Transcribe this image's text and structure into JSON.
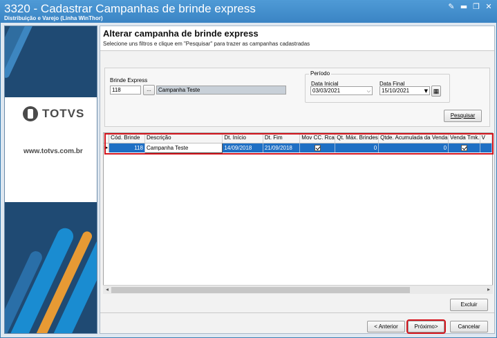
{
  "window": {
    "title": "3320 - Cadastrar Campanhas de brinde express",
    "subtitle": "Distribuição e Varejo (Linha WinThor)"
  },
  "banner": {
    "brand": "TOTVS",
    "site": "www.totvs.com.br"
  },
  "header": {
    "title": "Alterar campanha de brinde express",
    "instruction": "Selecione uns filtros e clique em \"Pesquisar\" para trazer as campanhas cadastradas"
  },
  "filters": {
    "brinde_label": "Brinde Express",
    "brinde_code": "118",
    "brinde_lookup_label": "...",
    "brinde_desc": "Campanha Teste",
    "periodo_label": "Período",
    "data_inicial_label": "Data Inicial",
    "data_inicial": "03/03/2021",
    "data_final_label": "Data Final",
    "data_final": "15/10/2021",
    "search_label": "Pesquisar"
  },
  "grid": {
    "columns": [
      "Cód. Brinde",
      "Descrição",
      "Dt. Início",
      "Dt. Fim",
      "Mov CC. Rca",
      "Qt. Máx. Brindes",
      "Qtde. Acumulada da Venda",
      "Venda Tmk.",
      "V"
    ],
    "rows": [
      {
        "cod": "118",
        "descricao": "Campanha Teste",
        "dt_inicio": "14/09/2018",
        "dt_fim": "21/09/2018",
        "mov_cc_rca": true,
        "qt_max_brindes": "0",
        "qtde_acumulada": "0",
        "venda_tmk": true
      }
    ]
  },
  "footer": {
    "excluir_label": "Excluir",
    "anterior_label": "< Anterior",
    "proximo_label": "Próximo>",
    "cancelar_label": "Cancelar"
  },
  "colors": {
    "titlebar": "#3a84c4",
    "selection": "#1e6fc4",
    "highlight": "#d4141c",
    "banner": "#1f4a73"
  }
}
